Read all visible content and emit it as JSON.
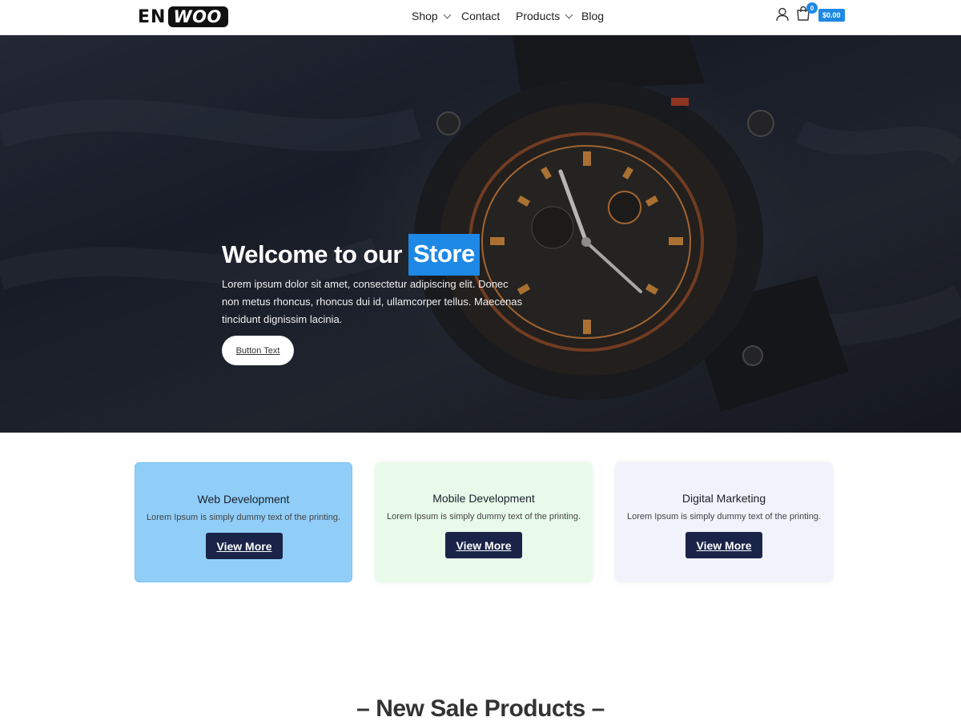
{
  "header": {
    "logo_part1": "EN",
    "logo_part2": "WOO",
    "nav": [
      {
        "label": "Shop",
        "has_dropdown": true
      },
      {
        "label": "Contact",
        "has_dropdown": false
      },
      {
        "label": "Products",
        "has_dropdown": true
      },
      {
        "label": "Blog",
        "has_dropdown": false
      }
    ],
    "icons": {
      "account": "user-icon",
      "cart": "cart-icon"
    },
    "cart_count": "0",
    "cart_total": "$0.00"
  },
  "hero": {
    "title_prefix": "Welcome to our",
    "title_highlight": "Store",
    "text": "Lorem ipsum dolor sit amet, consectetur adipiscing elit. Donec non metus rhoncus, rhoncus dui id, ullamcorper tellus. Maecenas tincidunt dignissim lacinia.",
    "button_label": "Button Text"
  },
  "services": [
    {
      "title": "Web Development",
      "description": "Lorem Ipsum is simply dummy text of the printing.",
      "button": "View More"
    },
    {
      "title": "Mobile Development",
      "description": "Lorem Ipsum is simply dummy text of the printing.",
      "button": "View More"
    },
    {
      "title": "Digital Marketing",
      "description": "Lorem Ipsum is simply dummy text of the printing.",
      "button": "View More"
    }
  ],
  "section_title": "– New Sale Products –",
  "colors": {
    "accent": "#1e88e5",
    "button_dark": "#1a2448",
    "card_blue": "#90cef8",
    "card_green": "#e8fbea",
    "card_lavender": "#f1f2fb"
  }
}
